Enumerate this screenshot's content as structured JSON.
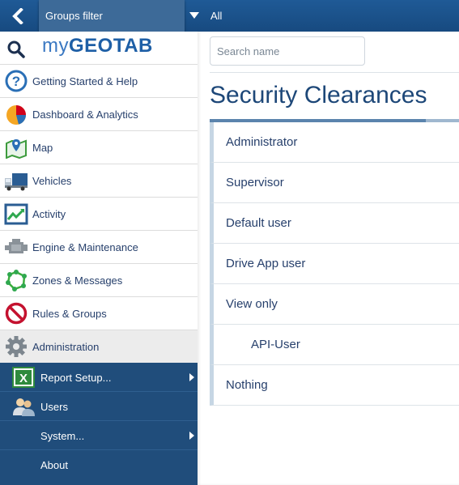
{
  "topbar": {
    "back_icon": "chevron-left-icon",
    "groups_filter_label": "Groups filter",
    "filter_caret_icon": "caret-down-icon",
    "filter_value": "All"
  },
  "brand": {
    "search_icon": "search-icon",
    "logo_my": "my",
    "logo_geotab": "GEOTAB"
  },
  "nav": {
    "items": [
      {
        "label": "Getting Started & Help",
        "icon": "help-icon"
      },
      {
        "label": "Dashboard & Analytics",
        "icon": "pie-chart-icon"
      },
      {
        "label": "Map",
        "icon": "map-icon"
      },
      {
        "label": "Vehicles",
        "icon": "truck-icon"
      },
      {
        "label": "Activity",
        "icon": "activity-chart-icon"
      },
      {
        "label": "Engine & Maintenance",
        "icon": "engine-icon"
      },
      {
        "label": "Zones & Messages",
        "icon": "zones-icon"
      },
      {
        "label": "Rules & Groups",
        "icon": "no-entry-icon"
      },
      {
        "label": "Administration",
        "icon": "gear-icon"
      }
    ],
    "active": "Administration"
  },
  "submenu": {
    "items": [
      {
        "label": "Report Setup...",
        "icon": "excel-icon",
        "has_arrow": true
      },
      {
        "label": "Users",
        "icon": "users-icon",
        "has_arrow": false
      },
      {
        "label": "System...",
        "icon": "",
        "has_arrow": true
      },
      {
        "label": "About",
        "icon": "",
        "has_arrow": false
      }
    ]
  },
  "main": {
    "search_placeholder": "Search name",
    "search_value": "",
    "title": "Security Clearances",
    "clearances": [
      {
        "label": "Administrator",
        "level": 0
      },
      {
        "label": "Supervisor",
        "level": 0
      },
      {
        "label": "Default user",
        "level": 0
      },
      {
        "label": "Drive App user",
        "level": 0
      },
      {
        "label": "View only",
        "level": 0
      },
      {
        "label": "API-User",
        "level": 1
      },
      {
        "label": "Nothing",
        "level": 0
      }
    ]
  },
  "colors": {
    "topbar": "#1f5a96",
    "submenu_bg": "#204d7b",
    "title": "#1d4778",
    "accent": "#5b84ad"
  }
}
